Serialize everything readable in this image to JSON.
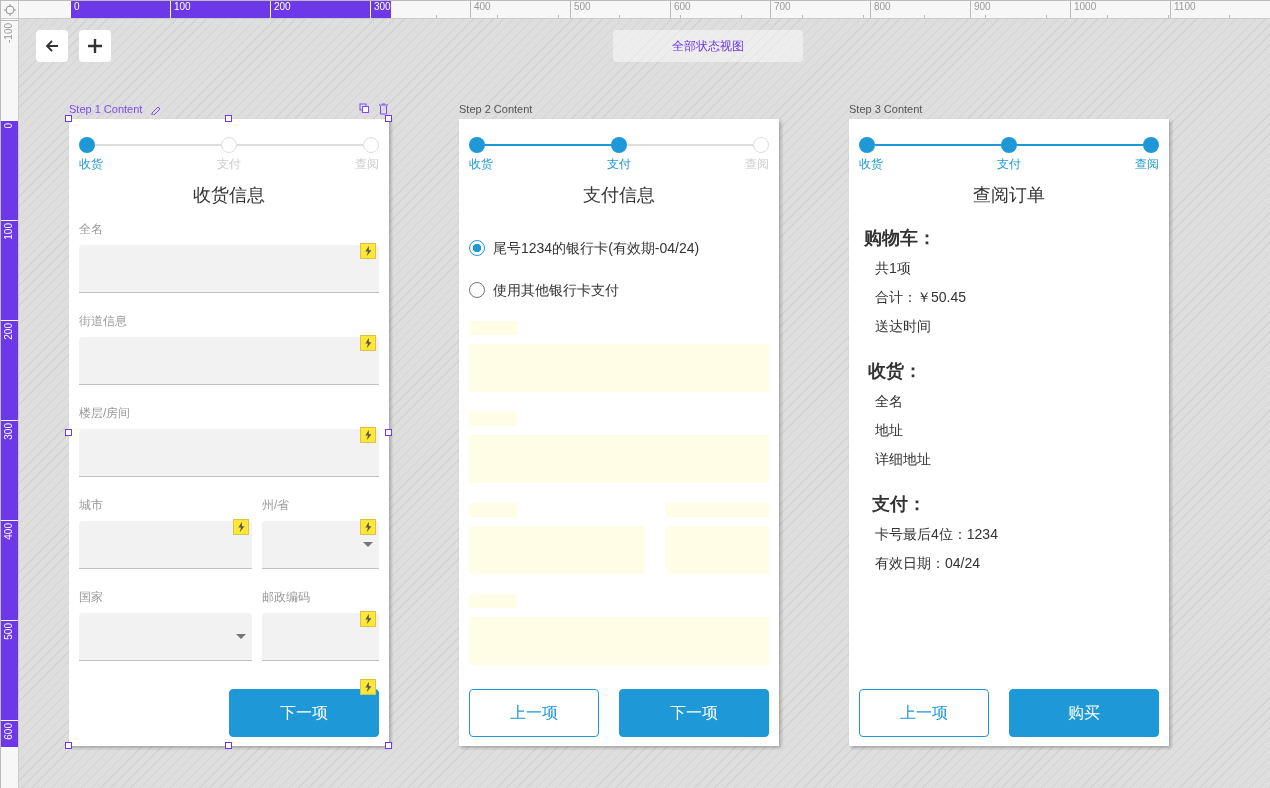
{
  "top_ruler": [
    "0",
    "100",
    "200",
    "300",
    "400",
    "500",
    "600",
    "700",
    "800",
    "900",
    "1000",
    "1100"
  ],
  "left_ruler": [
    "-100",
    "0",
    "100",
    "200",
    "300",
    "400",
    "500",
    "600"
  ],
  "view_button": "全部状态视图",
  "artboards": [
    {
      "label": "Step 1 Content",
      "selected": true,
      "kind": "form",
      "title": "收货信息",
      "steps": [
        {
          "label": "收货",
          "done": true
        },
        {
          "label": "支付",
          "done": false
        },
        {
          "label": "查阅",
          "done": false
        }
      ],
      "rows": [
        [
          {
            "label": "全名",
            "kind": "text",
            "flagged": true
          }
        ],
        [
          {
            "label": "街道信息",
            "kind": "text",
            "flagged": true
          }
        ],
        [
          {
            "label": "楼层/房间",
            "kind": "text",
            "flagged": true
          }
        ],
        [
          {
            "label": "城市",
            "kind": "text",
            "flagged": true
          },
          {
            "label": "州/省",
            "kind": "select",
            "flagged": true
          }
        ],
        [
          {
            "label": "国家",
            "kind": "select",
            "flagged": false
          },
          {
            "label": "邮政编码",
            "kind": "text",
            "flagged": true
          }
        ]
      ],
      "buttons": [
        {
          "label": "下一项",
          "kind": "primary",
          "flagged": true
        }
      ]
    },
    {
      "label": "Step 2 Content",
      "selected": false,
      "kind": "payment",
      "title": "支付信息",
      "steps": [
        {
          "label": "收货",
          "done": true
        },
        {
          "label": "支付",
          "done": true
        },
        {
          "label": "查阅",
          "done": false
        }
      ],
      "options": [
        {
          "label": "尾号1234的银行卡(有效期-04/24)",
          "selected": true
        },
        {
          "label": "使用其他银行卡支付",
          "selected": false
        }
      ],
      "buttons": [
        {
          "label": "上一项",
          "kind": "outline",
          "flagged": false
        },
        {
          "label": "下一项",
          "kind": "primary",
          "flagged": false
        }
      ]
    },
    {
      "label": "Step 3 Content",
      "selected": false,
      "kind": "review",
      "title": "查阅订单",
      "steps": [
        {
          "label": "收货",
          "done": true
        },
        {
          "label": "支付",
          "done": true
        },
        {
          "label": "查阅",
          "done": true
        }
      ],
      "sections": [
        {
          "heading": "购物车：",
          "items": [
            "共1项",
            "合计：￥50.45",
            "送达时间"
          ]
        },
        {
          "heading": "收货：",
          "items": [
            "全名",
            "地址",
            "详细地址"
          ]
        },
        {
          "heading": "支付：",
          "items": [
            "卡号最后4位：1234",
            "有效日期：04/24"
          ]
        }
      ],
      "buttons": [
        {
          "label": "上一项",
          "kind": "outline",
          "flagged": false
        },
        {
          "label": "购买",
          "kind": "primary",
          "flagged": false
        }
      ]
    }
  ]
}
